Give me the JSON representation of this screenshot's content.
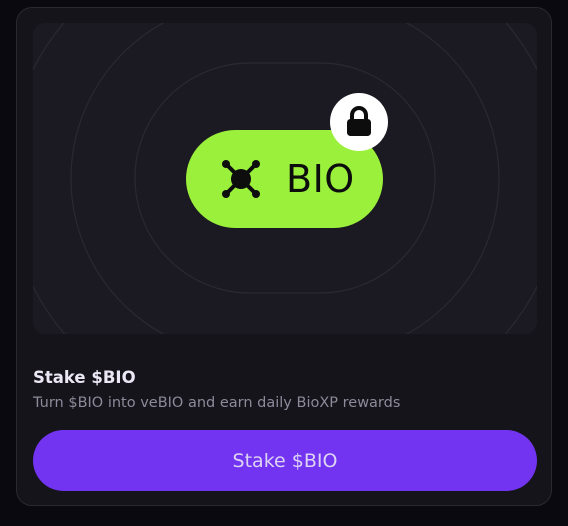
{
  "card": {
    "token_label": "BIO",
    "title": "Stake $BIO",
    "subtitle": "Turn $BIO into veBIO and earn daily BioXP rewards",
    "button_label": "Stake $BIO"
  },
  "icons": {
    "token_icon": "bio-bug-icon",
    "badge_icon": "lock-icon"
  },
  "colors": {
    "accent_green": "#9af03a",
    "accent_purple": "#7234f0",
    "card_bg": "#15141b",
    "hero_bg": "#1b1a22"
  }
}
